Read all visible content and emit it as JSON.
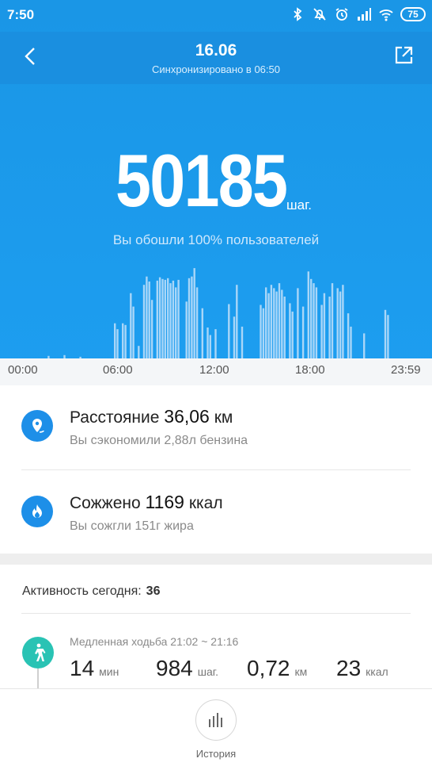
{
  "status": {
    "time": "7:50",
    "battery": "75"
  },
  "header": {
    "date": "16.06",
    "sync": "Синхронизировано в 06:50"
  },
  "steps": {
    "value": "50185",
    "unit": "шаг.",
    "subtitle": "Вы обошли 100% пользователей"
  },
  "chart_data": {
    "type": "bar",
    "x_start": "00:00",
    "x_end": "23:59",
    "xticks": [
      "00:00",
      "06:00",
      "12:00",
      "18:00",
      "23:59"
    ],
    "minutes_per_bar": 5,
    "values": [
      0,
      0,
      0,
      0,
      0,
      0,
      0,
      0,
      0,
      3,
      0,
      0,
      0,
      0,
      0,
      4,
      0,
      0,
      0,
      0,
      0,
      2,
      0,
      0,
      0,
      0,
      0,
      0,
      0,
      0,
      0,
      0,
      0,
      0,
      42,
      35,
      0,
      42,
      40,
      0,
      78,
      62,
      0,
      15,
      0,
      88,
      98,
      92,
      70,
      0,
      93,
      97,
      95,
      94,
      96,
      90,
      93,
      85,
      94,
      0,
      0,
      68,
      96,
      98,
      108,
      85,
      0,
      60,
      0,
      37,
      28,
      0,
      35,
      0,
      0,
      0,
      0,
      65,
      0,
      50,
      88,
      0,
      38,
      0,
      0,
      0,
      0,
      0,
      0,
      64,
      60,
      85,
      78,
      88,
      84,
      80,
      90,
      82,
      74,
      0,
      66,
      56,
      0,
      84,
      0,
      62,
      0,
      104,
      95,
      90,
      85,
      0,
      64,
      78,
      0,
      74,
      90,
      0,
      84,
      80,
      88,
      0,
      54,
      38,
      0,
      0,
      0,
      0,
      30,
      0,
      0,
      0,
      0,
      0,
      0,
      0,
      58,
      52,
      0,
      0,
      0,
      0,
      0,
      0,
      0
    ]
  },
  "stats": [
    {
      "label": "Расстояние",
      "value": "36,06",
      "unit": "км",
      "sub": "Вы сэкономили 2,88л бензина",
      "icon": "location-pin-icon"
    },
    {
      "label": "Сожжено",
      "value": "1169",
      "unit": "ккал",
      "sub": "Вы сожгли 151г жира",
      "icon": "flame-icon"
    }
  ],
  "activity": {
    "label": "Активность сегодня:",
    "count": "36",
    "item": {
      "title": "Медленная ходьба 21:02 ~ 21:16",
      "duration": "14",
      "duration_unit": "мин",
      "steps": "984",
      "steps_unit": "шаг.",
      "distance": "0,72",
      "distance_unit": "км",
      "calories": "23",
      "calories_unit": "ккал"
    }
  },
  "bottom": {
    "history_label": "История"
  },
  "colors": {
    "accent": "#1d8fe8",
    "hero": "#1d9ef0",
    "walk": "#29c3b4"
  }
}
